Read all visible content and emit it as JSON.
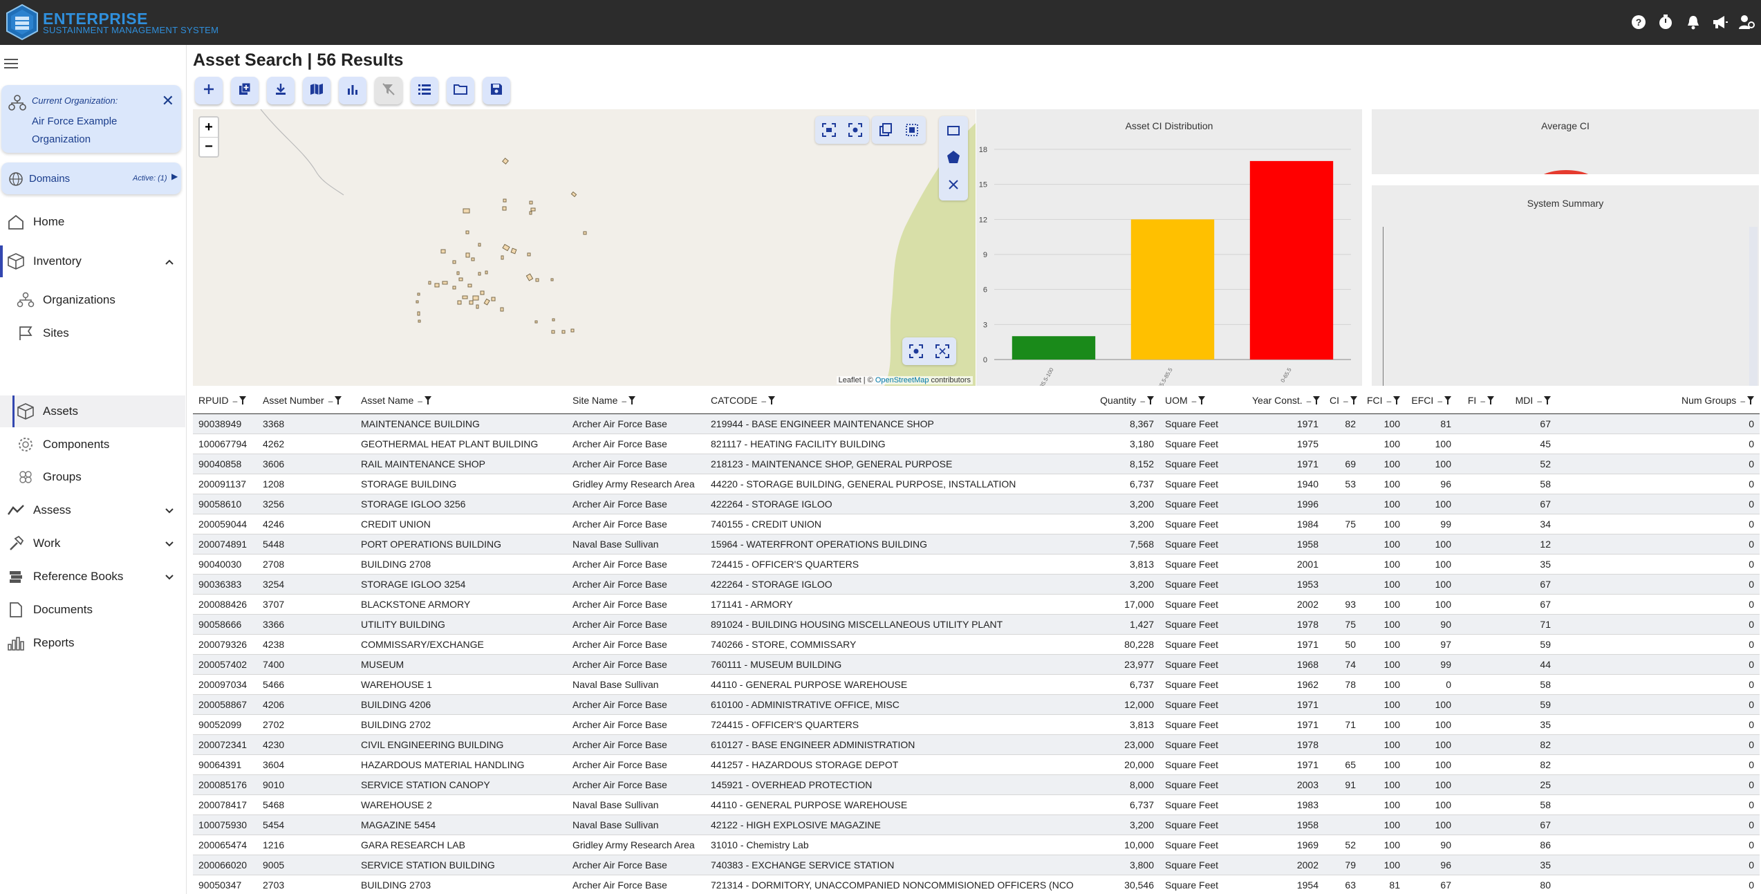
{
  "app": {
    "title": "ENTERPRISE",
    "subtitle": "SUSTAINMENT MANAGEMENT SYSTEM"
  },
  "topbar_icons": [
    "help-icon",
    "timer-icon",
    "bell-icon",
    "megaphone-icon",
    "user-settings-icon"
  ],
  "sidebar": {
    "org_label": "Current Organization:",
    "org_name": "Air Force Example Organization",
    "domains_label": "Domains",
    "domains_active": "Active: (1)",
    "items": [
      {
        "label": "Home",
        "icon": "home-icon"
      },
      {
        "label": "Inventory",
        "icon": "cube-icon"
      },
      {
        "label": "Organizations",
        "icon": "org-tree-icon"
      },
      {
        "label": "Sites",
        "icon": "flag-icon"
      },
      {
        "label": "Assets",
        "icon": "cube-icon"
      },
      {
        "label": "Components",
        "icon": "gear-icon"
      },
      {
        "label": "Groups",
        "icon": "groups-icon"
      },
      {
        "label": "Assess",
        "icon": "trend-icon"
      },
      {
        "label": "Work",
        "icon": "hammer-icon"
      },
      {
        "label": "Reference Books",
        "icon": "books-icon"
      },
      {
        "label": "Documents",
        "icon": "document-icon"
      },
      {
        "label": "Reports",
        "icon": "bar-chart-icon"
      }
    ]
  },
  "page": {
    "title": "Asset Search | 56 Results"
  },
  "toolbar": [
    "add-icon",
    "copy-add-icon",
    "download-icon",
    "map-icon",
    "chart-icon",
    "clear-filter-icon",
    "list-icon",
    "folder-icon",
    "save-icon"
  ],
  "map": {
    "zoom_in": "+",
    "zoom_out": "−",
    "attribution_prefix": "Leaflet | © ",
    "attribution_link": "OpenStreetMap",
    "attribution_suffix": " contributors"
  },
  "ci_chart": {
    "title": "Asset CI Distribution"
  },
  "avg_ci": {
    "title": "Average CI"
  },
  "summary": {
    "title": "System Summary"
  },
  "chart_data": {
    "type": "bar",
    "title": "Asset CI Distribution",
    "categories": [
      "85.5-100",
      "65.5-85.5",
      "0-65.5"
    ],
    "values": [
      2,
      12,
      17
    ],
    "colors": [
      "#1a8a1a",
      "#ffc000",
      "#ff0000"
    ],
    "ylim": [
      0,
      18
    ],
    "yticks": [
      0,
      3,
      6,
      9,
      12,
      15,
      18
    ],
    "grid": true
  },
  "table": {
    "columns": [
      "RPUID",
      "Asset Number",
      "Asset Name",
      "Site Name",
      "CATCODE",
      "Quantity",
      "UOM",
      "Year Const.",
      "CI",
      "FCI",
      "EFCI",
      "FI",
      "MDI",
      "Num Groups"
    ],
    "rows": [
      [
        "90038949",
        "3368",
        "MAINTENANCE BUILDING",
        "Archer Air Force Base",
        "219944 - BASE ENGINEER MAINTENANCE SHOP",
        "8,367",
        "Square Feet",
        "1971",
        "82",
        "100",
        "81",
        "",
        "67",
        "0"
      ],
      [
        "100067794",
        "4262",
        "GEOTHERMAL HEAT PLANT BUILDING",
        "Archer Air Force Base",
        "821117 - HEATING FACILITY BUILDING",
        "3,180",
        "Square Feet",
        "1975",
        "",
        "100",
        "100",
        "",
        "45",
        "0"
      ],
      [
        "90040858",
        "3606",
        "RAIL MAINTENANCE SHOP",
        "Archer Air Force Base",
        "218123 - MAINTENANCE SHOP, GENERAL PURPOSE",
        "8,152",
        "Square Feet",
        "1971",
        "69",
        "100",
        "100",
        "",
        "52",
        "0"
      ],
      [
        "200091137",
        "1208",
        "STORAGE BUILDING",
        "Gridley Army Research Area",
        "44220 - STORAGE BUILDING, GENERAL PURPOSE, INSTALLATION",
        "6,737",
        "Square Feet",
        "1940",
        "53",
        "100",
        "96",
        "",
        "58",
        "0"
      ],
      [
        "90058610",
        "3256",
        "STORAGE IGLOO 3256",
        "Archer Air Force Base",
        "422264 - STORAGE IGLOO",
        "3,200",
        "Square Feet",
        "1996",
        "",
        "100",
        "100",
        "",
        "67",
        "0"
      ],
      [
        "200059044",
        "4246",
        "CREDIT UNION",
        "Archer Air Force Base",
        "740155 - CREDIT UNION",
        "3,200",
        "Square Feet",
        "1984",
        "75",
        "100",
        "99",
        "",
        "34",
        "0"
      ],
      [
        "200074891",
        "5448",
        "PORT OPERATIONS BUILDING",
        "Naval Base Sullivan",
        "15964 - WATERFRONT OPERATIONS BUILDING",
        "7,568",
        "Square Feet",
        "1958",
        "",
        "100",
        "100",
        "",
        "12",
        "0"
      ],
      [
        "90040030",
        "2708",
        "BUILDING 2708",
        "Archer Air Force Base",
        "724415 - OFFICER'S QUARTERS",
        "3,813",
        "Square Feet",
        "2001",
        "",
        "100",
        "100",
        "",
        "35",
        "0"
      ],
      [
        "90036383",
        "3254",
        "STORAGE IGLOO 3254",
        "Archer Air Force Base",
        "422264 - STORAGE IGLOO",
        "3,200",
        "Square Feet",
        "1953",
        "",
        "100",
        "100",
        "",
        "67",
        "0"
      ],
      [
        "200088426",
        "3707",
        "BLACKSTONE ARMORY",
        "Archer Air Force Base",
        "171141 - ARMORY",
        "17,000",
        "Square Feet",
        "2002",
        "93",
        "100",
        "100",
        "",
        "67",
        "0"
      ],
      [
        "90058666",
        "3366",
        "UTILITY BUILDING",
        "Archer Air Force Base",
        "891024 - BUILDING HOUSING MISCELLANEOUS UTILITY PLANT",
        "1,427",
        "Square Feet",
        "1978",
        "75",
        "100",
        "90",
        "",
        "71",
        "0"
      ],
      [
        "200079326",
        "4238",
        "COMMISSARY/EXCHANGE",
        "Archer Air Force Base",
        "740266 - STORE, COMMISSARY",
        "80,228",
        "Square Feet",
        "1971",
        "50",
        "100",
        "97",
        "",
        "59",
        "0"
      ],
      [
        "200057402",
        "7400",
        "MUSEUM",
        "Archer Air Force Base",
        "760111 - MUSEUM BUILDING",
        "23,977",
        "Square Feet",
        "1968",
        "74",
        "100",
        "99",
        "",
        "44",
        "0"
      ],
      [
        "200097034",
        "5466",
        "WAREHOUSE 1",
        "Naval Base Sullivan",
        "44110 - GENERAL PURPOSE WAREHOUSE",
        "6,737",
        "Square Feet",
        "1962",
        "78",
        "100",
        "0",
        "",
        "58",
        "0"
      ],
      [
        "200058867",
        "4206",
        "BUILDING 4206",
        "Archer Air Force Base",
        "610100 - ADMINISTRATIVE OFFICE, MISC",
        "12,000",
        "Square Feet",
        "1971",
        "",
        "100",
        "100",
        "",
        "59",
        "0"
      ],
      [
        "90052099",
        "2702",
        "BUILDING 2702",
        "Archer Air Force Base",
        "724415 - OFFICER'S QUARTERS",
        "3,813",
        "Square Feet",
        "1971",
        "71",
        "100",
        "100",
        "",
        "35",
        "0"
      ],
      [
        "200072341",
        "4230",
        "CIVIL ENGINEERING BUILDING",
        "Archer Air Force Base",
        "610127 - BASE ENGINEER ADMINISTRATION",
        "23,000",
        "Square Feet",
        "1978",
        "",
        "100",
        "100",
        "",
        "82",
        "0"
      ],
      [
        "90064391",
        "3604",
        "HAZARDOUS MATERIAL HANDLING",
        "Archer Air Force Base",
        "441257 - HAZARDOUS STORAGE DEPOT",
        "20,000",
        "Square Feet",
        "1971",
        "65",
        "100",
        "100",
        "",
        "82",
        "0"
      ],
      [
        "200085176",
        "9010",
        "SERVICE STATION CANOPY",
        "Archer Air Force Base",
        "145921 - OVERHEAD PROTECTION",
        "8,000",
        "Square Feet",
        "2003",
        "91",
        "100",
        "100",
        "",
        "25",
        "0"
      ],
      [
        "200078417",
        "5468",
        "WAREHOUSE 2",
        "Naval Base Sullivan",
        "44110 - GENERAL PURPOSE WAREHOUSE",
        "6,737",
        "Square Feet",
        "1983",
        "",
        "100",
        "100",
        "",
        "58",
        "0"
      ],
      [
        "100075930",
        "5454",
        "MAGAZINE 5454",
        "Naval Base Sullivan",
        "42122 - HIGH EXPLOSIVE MAGAZINE",
        "3,200",
        "Square Feet",
        "1958",
        "",
        "100",
        "100",
        "",
        "67",
        "0"
      ],
      [
        "200065474",
        "1216",
        "GARA RESEARCH LAB",
        "Gridley Army Research Area",
        "31010 - Chemistry Lab",
        "10,000",
        "Square Feet",
        "1969",
        "52",
        "100",
        "90",
        "",
        "86",
        "0"
      ],
      [
        "200066020",
        "9005",
        "SERVICE STATION BUILDING",
        "Archer Air Force Base",
        "740383 - EXCHANGE SERVICE STATION",
        "3,800",
        "Square Feet",
        "2002",
        "79",
        "100",
        "96",
        "",
        "35",
        "0"
      ],
      [
        "90050347",
        "2703",
        "BUILDING 2703",
        "Archer Air Force Base",
        "721314 - DORMITORY, UNACCOMPANIED NONCOMMISIONED OFFICERS (NCO",
        "30,546",
        "Square Feet",
        "1954",
        "63",
        "81",
        "67",
        "",
        "80",
        "0"
      ]
    ]
  }
}
